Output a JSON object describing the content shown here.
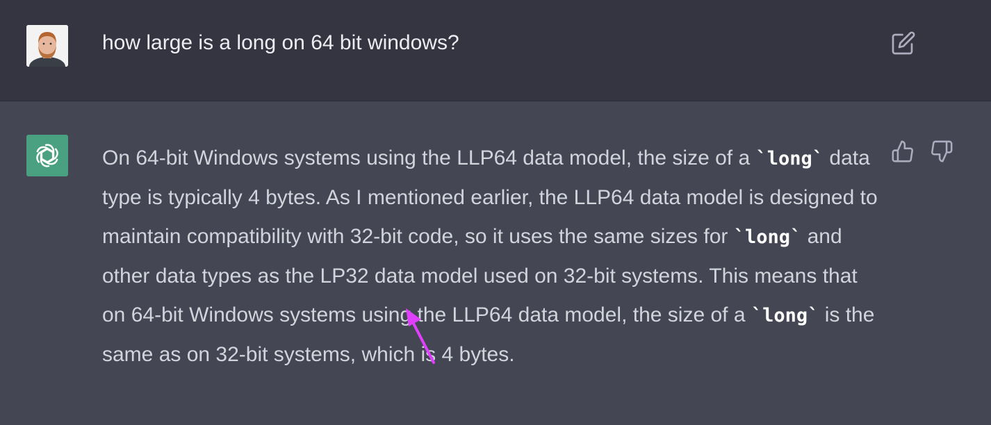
{
  "user_message": {
    "text": "how large is a long on 64 bit windows?",
    "avatar_icon": "user-avatar-icon",
    "edit_icon": "edit-icon"
  },
  "assistant_message": {
    "logo_icon": "openai-logo-icon",
    "logo_color": "#4aa181",
    "segments": [
      "On 64-bit Windows systems using the LLP64 data model, the size of a ",
      "`long`",
      " data type is typically 4 bytes. As I mentioned earlier, the LLP64 data model is designed to maintain compatibility with 32-bit code, so it uses the same sizes for ",
      "`long`",
      " and other data types as the LP32 data model used on 32-bit systems. This means that on 64-bit Windows systems using the LLP64 data model, the size of a ",
      "`long`",
      " is the same as on 32-bit systems, which is 4 bytes."
    ],
    "thumbs_up_icon": "thumbs-up-icon",
    "thumbs_down_icon": "thumbs-down-icon"
  },
  "colors": {
    "user_row_bg": "#343541",
    "assistant_row_bg": "#444654",
    "annotation_arrow": "#e040fb"
  }
}
